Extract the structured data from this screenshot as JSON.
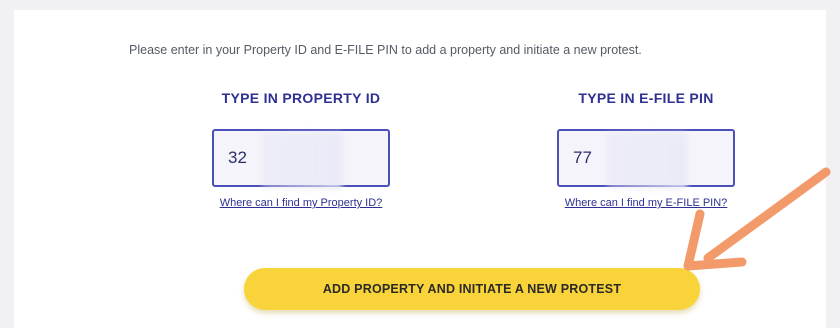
{
  "instruction_text": "Please enter in your Property ID and E-FILE PIN to add a property and initiate a new protest.",
  "property_id": {
    "title": "TYPE IN PROPERTY ID",
    "value": "32",
    "help_link": "Where can I find my Property ID?"
  },
  "efile_pin": {
    "title": "TYPE IN E-FILE PIN",
    "value": "77",
    "help_link": "Where can I find my E-FILE PIN?"
  },
  "cta_label": "ADD PROPERTY AND INITIATE A NEW PROTEST",
  "colors": {
    "accent": "#2e3192",
    "button": "#f8d33a",
    "arrow": "#f39a6b"
  },
  "annotation_icon": "arrow-pointer-icon"
}
